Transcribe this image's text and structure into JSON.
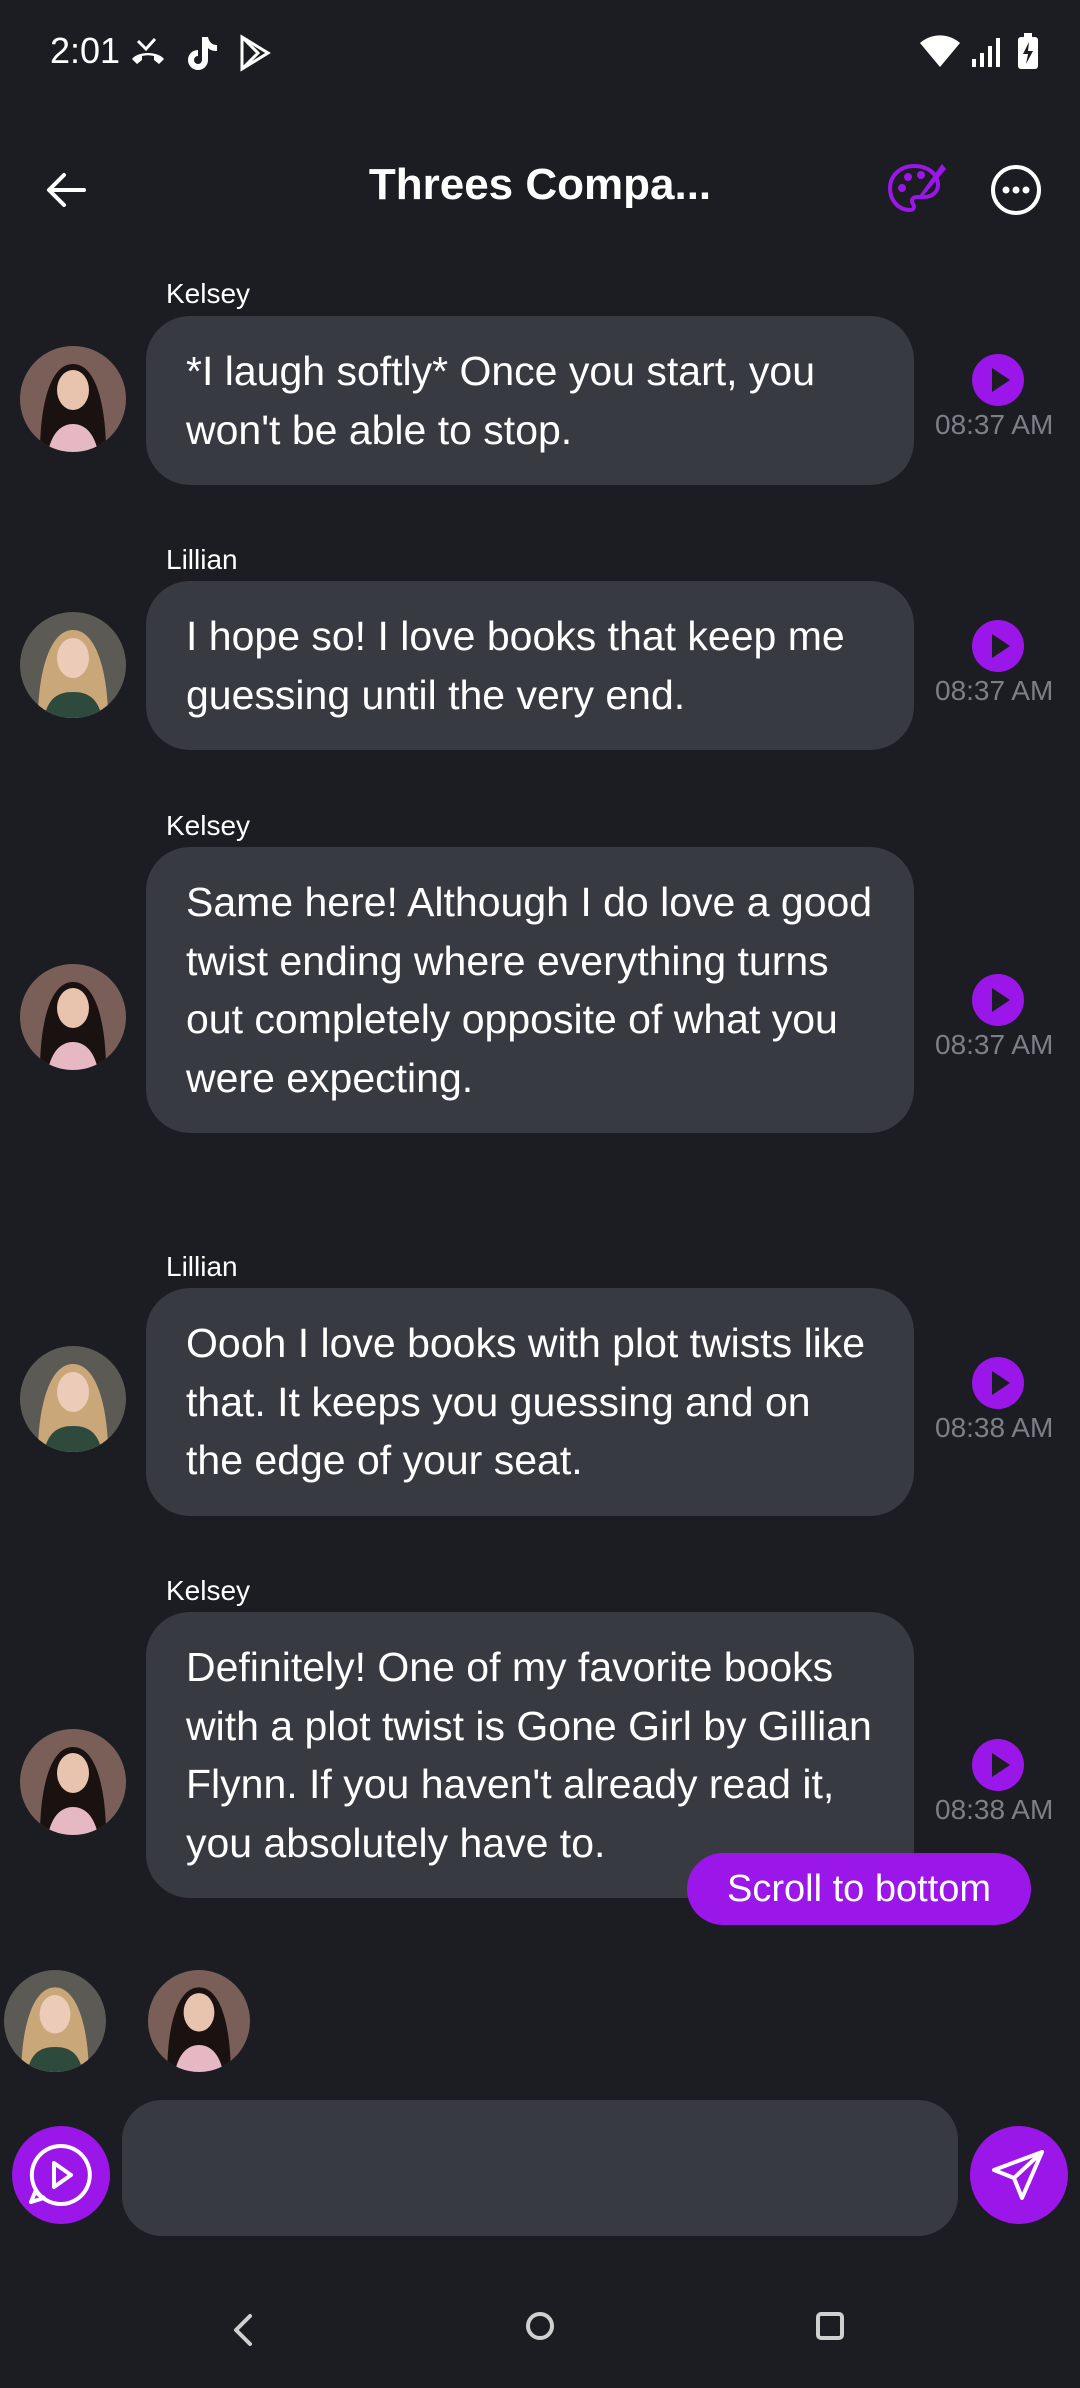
{
  "status_bar": {
    "time": "2:01",
    "left_icons": [
      "missed-call-icon",
      "tiktok-icon",
      "play-store-icon"
    ],
    "right_icons": [
      "wifi-icon",
      "signal-icon",
      "battery-charging-icon"
    ]
  },
  "header": {
    "title": "Threes Compa...",
    "back_icon": "arrow-left-icon",
    "palette_icon": "palette-icon",
    "more_icon": "more-horizontal-icon"
  },
  "messages": [
    {
      "sender": "Kelsey",
      "text": "*I laugh softly* Once you start, you won't be able to stop.",
      "time": "08:37 AM",
      "avatar": "kelsey"
    },
    {
      "sender": "Lillian",
      "text": "I hope so! I love books that keep me guessing until the very end.",
      "time": "08:37 AM",
      "avatar": "lillian"
    },
    {
      "sender": "Kelsey",
      "text": "Same here! Although I do love a good twist ending where everything turns out completely opposite of what you were expecting.",
      "time": "08:37 AM",
      "avatar": "kelsey"
    },
    {
      "sender": "Lillian",
      "text": "Oooh I love books with plot twists like that. It keeps you guessing and on the edge of your seat.",
      "time": "08:38 AM",
      "avatar": "lillian"
    },
    {
      "sender": "Kelsey",
      "text": "Definitely! One of my favorite books with a plot twist is Gone Girl by Gillian Flynn. If you haven't already read it, you absolutely have to.",
      "time": "08:38 AM",
      "avatar": "kelsey"
    }
  ],
  "scroll_button": "Scroll to bottom",
  "composer": {
    "placeholder": "",
    "voice_icon": "voice-chat-icon",
    "send_icon": "send-icon"
  },
  "colors": {
    "background": "#1c1d22",
    "bubble": "#383a41",
    "accent": "#9b16e8",
    "timestamp": "#7d7f87"
  },
  "nav_bar": [
    "back-icon",
    "home-icon",
    "recents-icon"
  ]
}
